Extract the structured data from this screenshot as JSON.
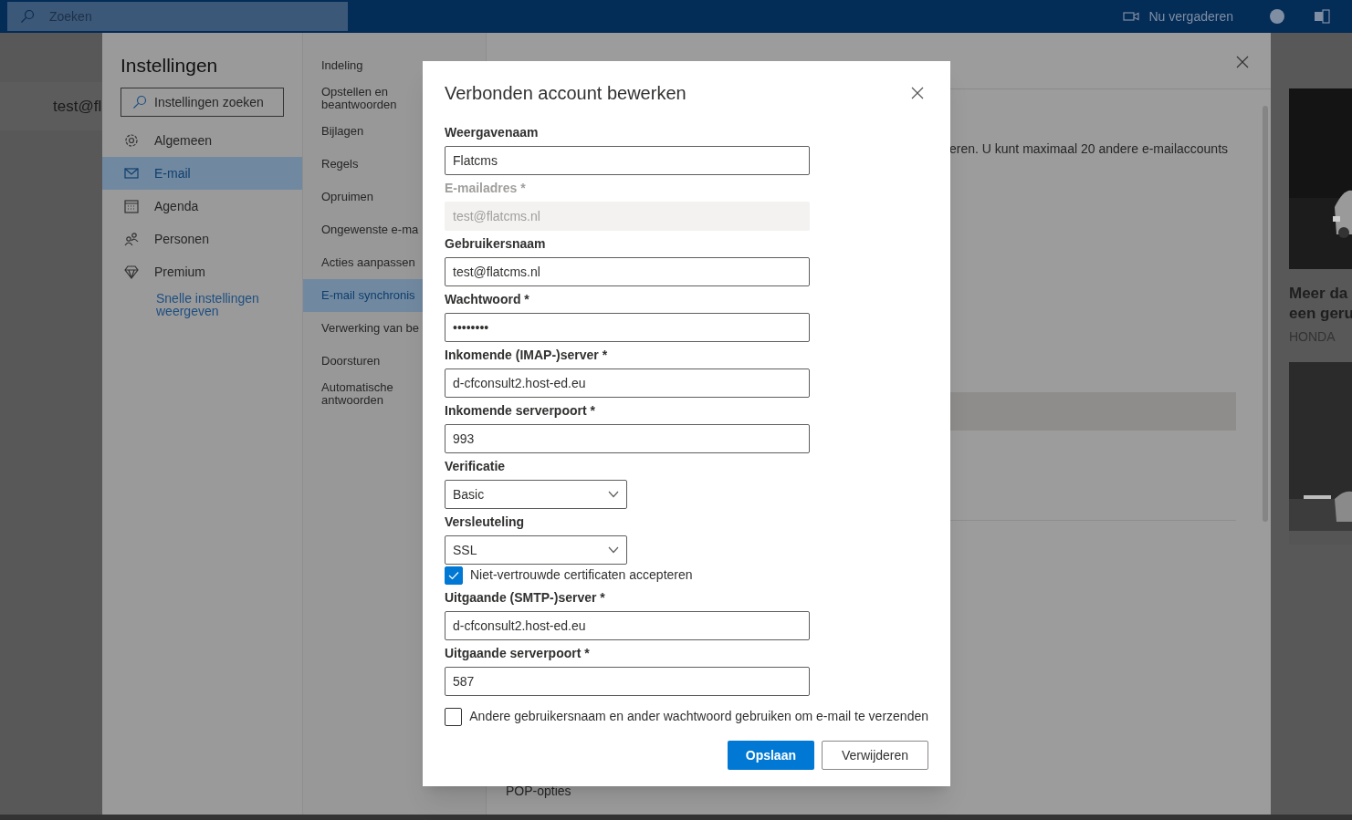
{
  "top_bar": {
    "search": {
      "placeholder": "Zoeken"
    },
    "meeting_button": "Nu vergaderen"
  },
  "background": {
    "account": "test@fl"
  },
  "settings": {
    "title": "Instellingen",
    "search": {
      "placeholder": "Instellingen zoeken"
    },
    "categories": [
      {
        "label": "Algemeen",
        "selected": false
      },
      {
        "label": "E-mail",
        "selected": true
      },
      {
        "label": "Agenda",
        "selected": false
      },
      {
        "label": "Personen",
        "selected": false
      },
      {
        "label": "Premium",
        "selected": false
      }
    ],
    "quick_link": "Snelle instellingen weergeven",
    "subcategories": [
      {
        "label": "Indeling",
        "selected": false
      },
      {
        "label": "Opstellen en beantwoorden",
        "selected": false
      },
      {
        "label": "Bijlagen",
        "selected": false
      },
      {
        "label": "Regels",
        "selected": false
      },
      {
        "label": "Opruimen",
        "selected": false
      },
      {
        "label": "Ongewenste e-ma",
        "selected": false
      },
      {
        "label": "Acties aanpassen",
        "selected": false
      },
      {
        "label": "E-mail synchronis",
        "selected": true
      },
      {
        "label": "Verwerking van be",
        "selected": false
      },
      {
        "label": "Doorsturen",
        "selected": false
      },
      {
        "label": "Automatische antwoorden",
        "selected": false
      }
    ],
    "pane": {
      "text": "eren. U kunt maximaal 20 andere e-mailaccounts",
      "section": "POP-opties"
    }
  },
  "ad": {
    "headline": [
      "Meer da",
      "een geru"
    ],
    "advertiser": "HONDA"
  },
  "dialog": {
    "title": "Verbonden account bewerken",
    "fields": [
      {
        "kind": "text",
        "label": "Weergavenaam",
        "value": "Flatcms",
        "disabled": false
      },
      {
        "kind": "text",
        "label": "E-mailadres *",
        "value": "test@flatcms.nl",
        "disabled": true
      },
      {
        "kind": "text",
        "label": "Gebruikersnaam",
        "value": "test@flatcms.nl",
        "disabled": false
      },
      {
        "kind": "text",
        "label": "Wachtwoord *",
        "value": "••••••••",
        "disabled": false
      },
      {
        "kind": "text",
        "label": "Inkomende (IMAP-)server *",
        "value": "d-cfconsult2.host-ed.eu",
        "disabled": false
      },
      {
        "kind": "text",
        "label": "Inkomende serverpoort *",
        "value": "993",
        "disabled": false
      },
      {
        "kind": "select",
        "label": "Verificatie",
        "value": "Basic"
      },
      {
        "kind": "select",
        "label": "Versleuteling",
        "value": "SSL"
      },
      {
        "kind": "checkbox",
        "label": "Niet-vertrouwde certificaten accepteren",
        "checked": true
      },
      {
        "kind": "text",
        "label": "Uitgaande (SMTP-)server *",
        "value": "d-cfconsult2.host-ed.eu",
        "disabled": false
      },
      {
        "kind": "text",
        "label": "Uitgaande serverpoort *",
        "value": "587",
        "disabled": false
      },
      {
        "kind": "checkbox",
        "label": "Andere gebruikersnaam en ander wachtwoord gebruiken om e-mail te verzenden",
        "checked": false
      }
    ],
    "buttons": [
      {
        "label": "Opslaan",
        "primary": true
      },
      {
        "label": "Verwijderen",
        "primary": false
      }
    ]
  }
}
